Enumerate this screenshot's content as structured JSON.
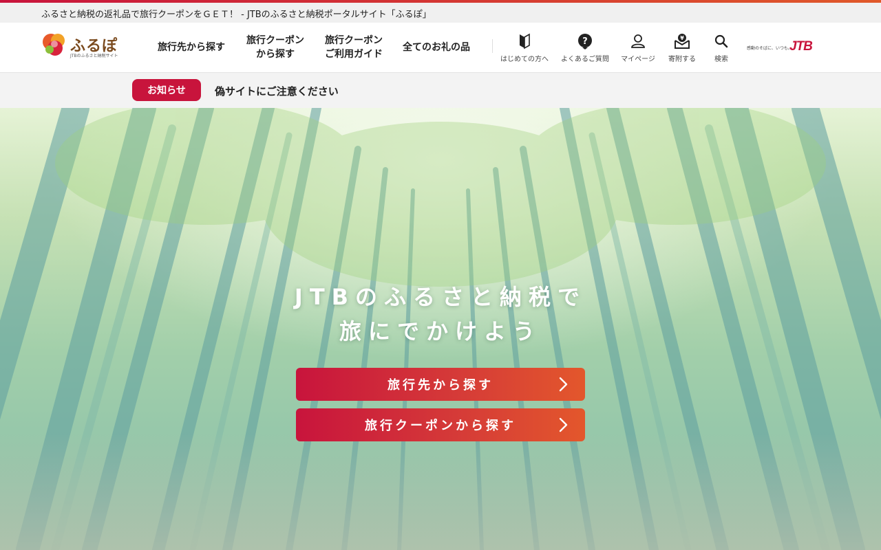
{
  "topbar": {
    "site_title": "ふるさと納税の返礼品で旅行クーポンをＧＥＴ！ - JTBのふるさと納税ポータルサイト「ふるぽ」"
  },
  "header": {
    "logo_text": "ふるぽ",
    "logo_sub": "JTBのふるさと納税サイト",
    "nav": [
      {
        "label": "旅行先から探す"
      },
      {
        "label": "旅行クーポン\nから探す"
      },
      {
        "label": "旅行クーポン\nご利用ガイド"
      },
      {
        "label": "全てのお礼の品"
      }
    ],
    "utility": [
      {
        "label": "はじめての方へ",
        "icon": "beginner-icon"
      },
      {
        "label": "よくあるご質問",
        "icon": "question-icon"
      },
      {
        "label": "マイページ",
        "icon": "user-icon"
      },
      {
        "label": "寄附する",
        "icon": "donate-icon"
      },
      {
        "label": "検索",
        "icon": "search-icon"
      }
    ],
    "jtb_tagline": "感動のそばに、いつも。",
    "jtb_logo": "JTB"
  },
  "notice": {
    "badge": "お知らせ",
    "text": "偽サイトにご注意ください"
  },
  "hero": {
    "heading_line1": "JTBのふるさと納税で",
    "heading_line2": "旅にでかけよう",
    "cta_primary": "旅行先から探す",
    "cta_secondary": "旅行クーポンから探す"
  },
  "colors": {
    "brand": "#c8143c",
    "brand_gradient_end": "#e3572c"
  }
}
